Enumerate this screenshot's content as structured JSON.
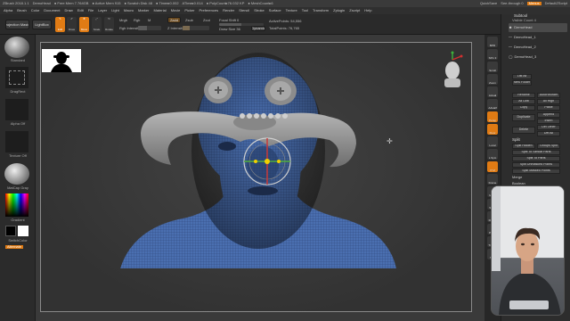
{
  "titlebar": {
    "app": "ZBrush 2018.1.1",
    "doc": "DemoHead",
    "stats": [
      "● Free Mem 7.764GB",
      "● Active Mem 915",
      "● Scratch Disk 48",
      "● Timer▸0.002",
      "ATime▸0.014",
      "● PolyCount▸76.032 KP",
      "● MeshCount▸6"
    ],
    "right": [
      "QuickSave",
      "See-through 0",
      "Menus",
      "DefaultZScript"
    ]
  },
  "menus": [
    "Alpha",
    "Brush",
    "Color",
    "Document",
    "Draw",
    "Edit",
    "File",
    "Layer",
    "Light",
    "Macro",
    "Marker",
    "Material",
    "Movie",
    "Picker",
    "Preferences",
    "Render",
    "Stencil",
    "Stroke",
    "Surface",
    "Texture",
    "Tool",
    "Transform",
    "Zplugin",
    "Zscript",
    "Help"
  ],
  "toolbar": {
    "projection": "Projection Master",
    "lightbox": "LightBox",
    "tools": [
      "Edit",
      "Draw",
      "Move",
      "Scale",
      "Rotate"
    ],
    "mrgb": "Mrgb",
    "rgb": "Rgb",
    "m": "M",
    "zadd": "Zadd",
    "zsub": "Zsub",
    "zcut": "Zcut",
    "rgb_intensity": "Rgb Intensity",
    "z_intensity": "Z Intensity",
    "focal_shift": "Focal Shift 0",
    "draw_size": "Draw Size 36",
    "dynamic": "Dynamic",
    "active_points": "ActivePoints: 54,556",
    "total_points": "TotalPoints: 76,765"
  },
  "left": {
    "brush": "Standard",
    "stroke": "DragRect",
    "alpha": "Alpha Off",
    "texture": "Texture Off",
    "material": "MatCap Gray",
    "gradient": "Gradient",
    "switch": "SwitchColor",
    "alternate": "Alternate"
  },
  "righttools": [
    "BPR",
    "SPix 3",
    "Scroll",
    "Zoom",
    "Actual",
    "AAHalf",
    "Persp",
    "Floor",
    "Local",
    "L.Sym",
    "XYZ",
    "Frame",
    "Move",
    "Scale",
    "Rotate",
    "PolyF",
    "Transp",
    "Solo"
  ],
  "subtool": {
    "title": "Subtool",
    "visible_count": "Visible Count 4",
    "items": [
      "DemoHead",
      "DemoHead_1",
      "DemoHead_2",
      "DemoHead_3"
    ],
    "list_all": "List All",
    "new_folder": "New Folder",
    "rename": "Rename",
    "autoreorder": "AutoReorder",
    "all_low": "All Low",
    "all_high": "All High",
    "copy": "Copy",
    "paste": "Paste",
    "duplicate": "Duplicate",
    "append": "Append",
    "insert": "Insert",
    "delete": "Delete",
    "del_other": "Del Other",
    "del_all": "Del All",
    "split_header": "Split",
    "split_hidden": "Split Hidden",
    "groups_split": "Groups Split",
    "split_similar": "Split To Similar Parts",
    "split_parts": "Split To Parts",
    "split_unmasked": "Split Unmasked Points",
    "split_masked": "Split Masked Points",
    "merge": "Merge",
    "boolean": "Boolean"
  },
  "colors": {
    "accent": "#e07b14",
    "mesh": "#4a6fb0",
    "mustache": "#9a9a9a"
  }
}
